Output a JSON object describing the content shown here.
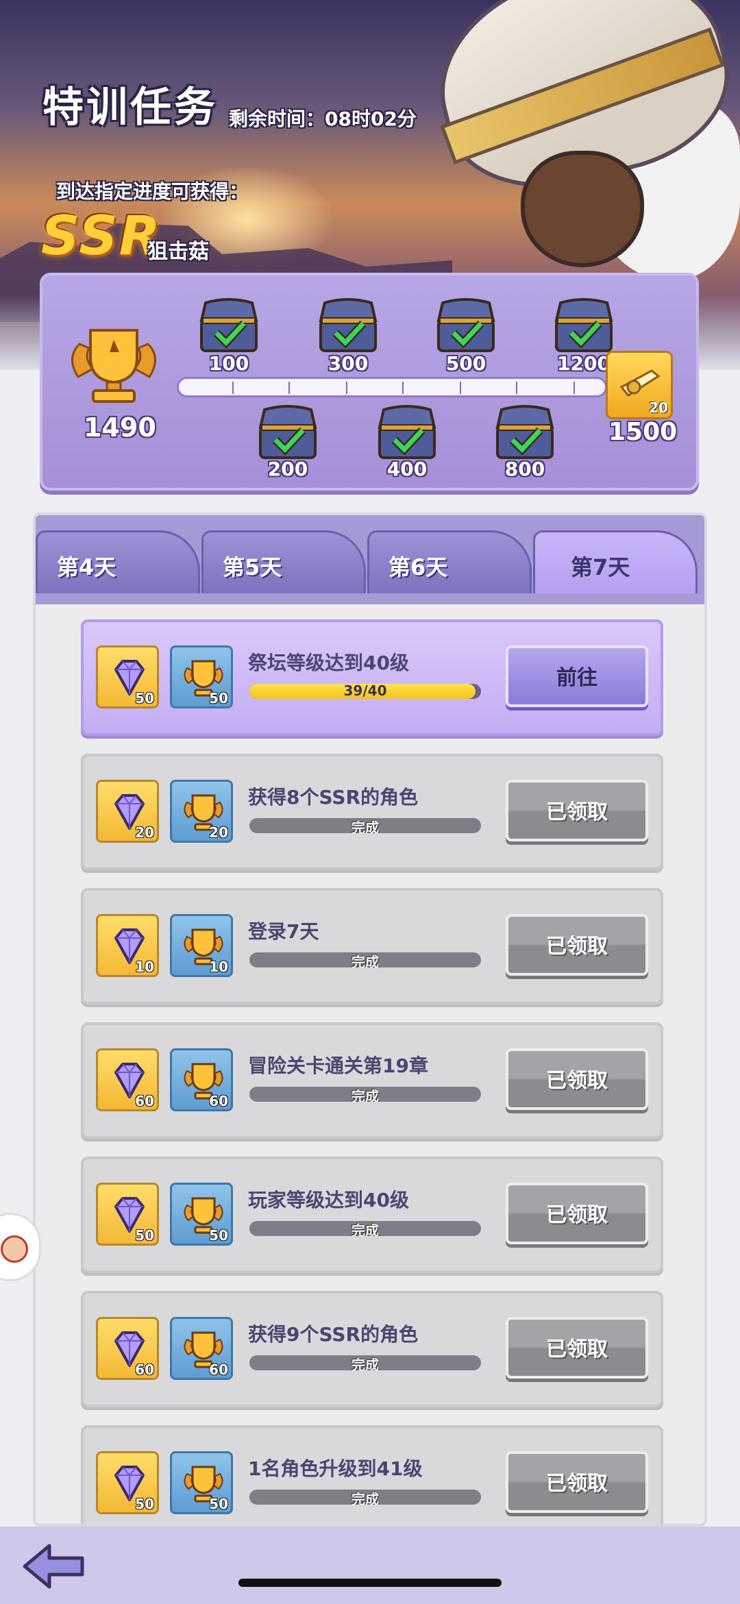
{
  "header": {
    "title": "特训任务",
    "remaining_time": "剩余时间：08时02分",
    "reach_text": "到达指定进度可获得：",
    "ssr_badge": "SSR",
    "reward_name": "狙击菇"
  },
  "progress": {
    "current_value": "1490",
    "milestones_top": [
      "100",
      "300",
      "500",
      "1200"
    ],
    "milestones_bottom": [
      "200",
      "400",
      "800"
    ],
    "final_value": "1500",
    "final_reward_count": "20"
  },
  "tabs": [
    {
      "label": "第4天",
      "active": false
    },
    {
      "label": "第5天",
      "active": false
    },
    {
      "label": "第6天",
      "active": false
    },
    {
      "label": "第7天",
      "active": true
    }
  ],
  "tasks": [
    {
      "title": "祭坛等级达到40级",
      "gem": "50",
      "cup": "50",
      "progress_text": "39/40",
      "progress_fraction": 0.975,
      "button": "前往",
      "state": "go"
    },
    {
      "title": "获得8个SSR的角色",
      "gem": "20",
      "cup": "20",
      "progress_text": "完成",
      "progress_fraction": 1,
      "button": "已领取",
      "state": "done"
    },
    {
      "title": "登录7天",
      "gem": "10",
      "cup": "10",
      "progress_text": "完成",
      "progress_fraction": 1,
      "button": "已领取",
      "state": "done"
    },
    {
      "title": "冒险关卡通关第19章",
      "gem": "60",
      "cup": "60",
      "progress_text": "完成",
      "progress_fraction": 1,
      "button": "已领取",
      "state": "done"
    },
    {
      "title": "玩家等级达到40级",
      "gem": "50",
      "cup": "50",
      "progress_text": "完成",
      "progress_fraction": 1,
      "button": "已领取",
      "state": "done"
    },
    {
      "title": "获得9个SSR的角色",
      "gem": "60",
      "cup": "60",
      "progress_text": "完成",
      "progress_fraction": 1,
      "button": "已领取",
      "state": "done"
    },
    {
      "title": "1名角色升级到41级",
      "gem": "50",
      "cup": "50",
      "progress_text": "完成",
      "progress_fraction": 1,
      "button": "已领取",
      "state": "done"
    }
  ],
  "icons": {
    "back": "arrow-left-icon",
    "gem": "diamond-icon",
    "cup": "trophy-icon",
    "chest": "treasure-chest-icon",
    "check": "checkmark-icon"
  },
  "colors": {
    "accent_purple": "#a68fd6",
    "progress_yellow": "#f2c51c",
    "done_gray": "#8c8c90"
  }
}
